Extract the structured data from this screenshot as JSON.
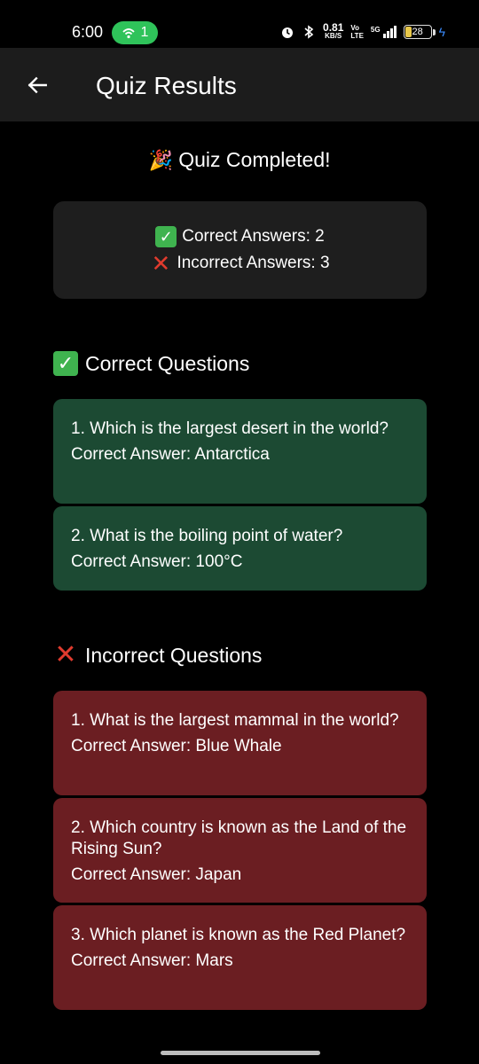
{
  "status_bar": {
    "time": "6:00",
    "hotspot_count": "1",
    "net_speed_value": "0.81",
    "net_speed_unit": "KB/S",
    "volte_top": "Vo",
    "volte_bottom": "LTE",
    "network_type": "5G",
    "battery_level": "28",
    "accent_color": "#2fc35a"
  },
  "app_bar": {
    "title": "Quiz Results",
    "back_icon": "arrow-left-icon"
  },
  "completed": {
    "emoji": "🎉",
    "title": "Quiz Completed!"
  },
  "summary": {
    "correct_label": "Correct Answers: 2",
    "incorrect_label": "Incorrect Answers: 3"
  },
  "correct_section": {
    "heading": "Correct Questions",
    "color": "#1c4a33",
    "items": [
      {
        "question": "1. Which is the largest desert in the world?",
        "answer": "Correct Answer: Antarctica"
      },
      {
        "question": "2. What is the boiling point of water?",
        "answer": "Correct Answer: 100°C"
      }
    ]
  },
  "incorrect_section": {
    "heading": "Incorrect Questions",
    "color": "#6b1e22",
    "items": [
      {
        "question": "1. What is the largest mammal in the world?",
        "answer": "Correct Answer: Blue Whale"
      },
      {
        "question": "2. Which country is known as the Land of the Rising Sun?",
        "answer": "Correct Answer: Japan"
      },
      {
        "question": "3. Which planet is known as the Red Planet?",
        "answer": "Correct Answer: Mars"
      }
    ]
  }
}
